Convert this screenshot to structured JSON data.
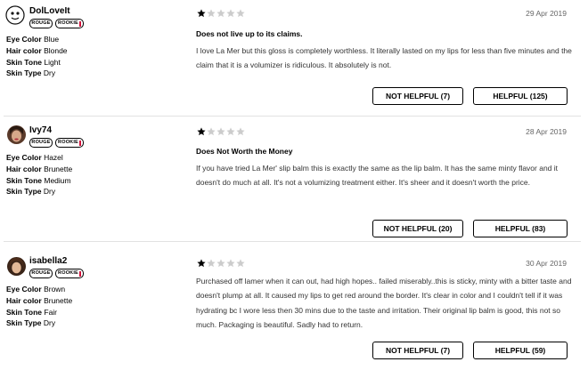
{
  "reviews": [
    {
      "username": "DolLoveIt",
      "badges": [
        "ROUGE",
        "ROOKIE"
      ],
      "attributes": [
        {
          "key": "Eye Color",
          "value": "Blue"
        },
        {
          "key": "Hair color",
          "value": "Blonde"
        },
        {
          "key": "Skin Tone",
          "value": "Light"
        },
        {
          "key": "Skin Type",
          "value": "Dry"
        }
      ],
      "rating": 1,
      "rating_max": 5,
      "date": "29 Apr 2019",
      "title": "Does not live up to its claims.",
      "body": "I love La Mer but this gloss is completely worthless. It literally lasted on my lips for less than five minutes and the claim that it is a volumizer is ridiculous. It absolutely is not.",
      "not_helpful_label": "NOT HELPFUL (7)",
      "helpful_label": "HELPFUL (125)"
    },
    {
      "username": "Ivy74",
      "badges": [
        "ROUGE",
        "ROOKIE"
      ],
      "attributes": [
        {
          "key": "Eye Color",
          "value": "Hazel"
        },
        {
          "key": "Hair color",
          "value": "Brunette"
        },
        {
          "key": "Skin Tone",
          "value": "Medium"
        },
        {
          "key": "Skin Type",
          "value": "Dry"
        }
      ],
      "rating": 1,
      "rating_max": 5,
      "date": "28 Apr 2019",
      "title": "Does Not Worth the Money",
      "body": "If you have tried La Mer' slip balm this is exactly the same as the lip balm. It has the same minty flavor and it doesn't do much at all. It's not a volumizing treatment either. It's sheer and it doesn't worth the price.",
      "not_helpful_label": "NOT HELPFUL (20)",
      "helpful_label": "HELPFUL (83)"
    },
    {
      "username": "isabella2",
      "badges": [
        "ROUGE",
        "ROOKIE"
      ],
      "attributes": [
        {
          "key": "Eye Color",
          "value": "Brown"
        },
        {
          "key": "Hair color",
          "value": "Brunette"
        },
        {
          "key": "Skin Tone",
          "value": "Fair"
        },
        {
          "key": "Skin Type",
          "value": "Dry"
        }
      ],
      "rating": 1,
      "rating_max": 5,
      "date": "30 Apr 2019",
      "title": "",
      "body": "Purchased off lamer when it can out, had high hopes.. failed miserably..this is sticky, minty with a bitter taste and doesn't plump at all. It caused my lips to get red around the border. It's clear in color and I couldn't tell if it was hydrating bc I wore less then 30 mins due to the taste and irritation. Their original lip balm is good, this not so much. Packaging is beautiful. Sadly had to return.",
      "not_helpful_label": "NOT HELPFUL (7)",
      "helpful_label": "HELPFUL (59)"
    }
  ],
  "colors": {
    "star_filled": "#000000",
    "star_empty": "#cccccc",
    "rookie_accent": "#d0103a",
    "divider": "#e2e2e2"
  }
}
